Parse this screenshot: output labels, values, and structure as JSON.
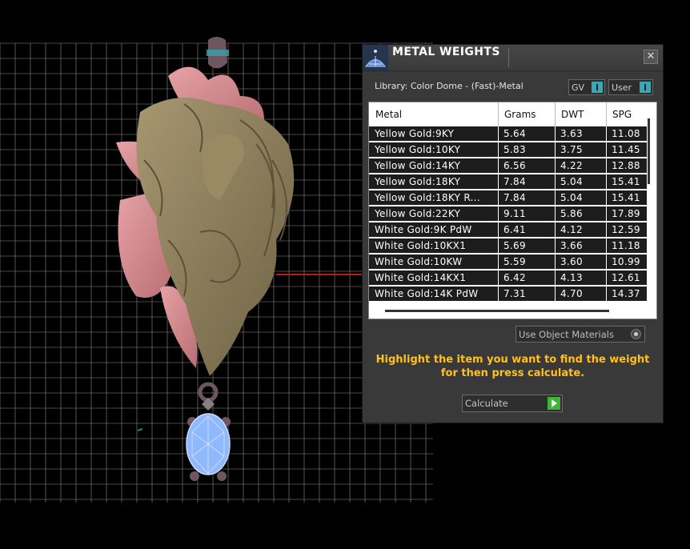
{
  "panel": {
    "title": "METAL WEIGHTS",
    "close_glyph": "✕",
    "library_label": "Library: Color Dome - (Fast)-Metal",
    "toggle_gv_label": "GV",
    "toggle_user_label": "User",
    "table": {
      "headers": [
        "Metal",
        "Grams",
        "DWT",
        "SPG"
      ],
      "rows": [
        {
          "metal": "Yellow Gold:9KY",
          "grams": "5.64",
          "dwt": "3.63",
          "spg": "11.08"
        },
        {
          "metal": "Yellow Gold:10KY",
          "grams": "5.83",
          "dwt": "3.75",
          "spg": "11.45"
        },
        {
          "metal": "Yellow Gold:14KY",
          "grams": "6.56",
          "dwt": "4.22",
          "spg": "12.88"
        },
        {
          "metal": "Yellow Gold:18KY",
          "grams": "7.84",
          "dwt": "5.04",
          "spg": "15.41"
        },
        {
          "metal": "Yellow Gold:18KY R...",
          "grams": "7.84",
          "dwt": "5.04",
          "spg": "15.41"
        },
        {
          "metal": "Yellow Gold:22KY",
          "grams": "9.11",
          "dwt": "5.86",
          "spg": "17.89"
        },
        {
          "metal": "White Gold:9K PdW",
          "grams": "6.41",
          "dwt": "4.12",
          "spg": "12.59"
        },
        {
          "metal": "White Gold:10KX1",
          "grams": "5.69",
          "dwt": "3.66",
          "spg": "11.18"
        },
        {
          "metal": "White Gold:10KW",
          "grams": "5.59",
          "dwt": "3.60",
          "spg": "10.99"
        },
        {
          "metal": "White Gold:14KX1",
          "grams": "6.42",
          "dwt": "4.13",
          "spg": "12.61"
        },
        {
          "metal": "White Gold:14K PdW",
          "grams": "7.31",
          "dwt": "4.70",
          "spg": "14.37"
        }
      ]
    },
    "use_object_materials_label": "Use Object Materials",
    "hint_line1": "Highlight the item you want to find the weight",
    "hint_line2": "for then press calculate.",
    "calculate_label": "Calculate"
  },
  "colors": {
    "panel_bg": "#393939",
    "hint_text": "#ffc11a",
    "toggle_accent": "#3aa7b7",
    "calculate_accent": "#3fb43a",
    "pendant_gold": "#8e7f5c",
    "pendant_pink": "#d98a8f",
    "gem_blue": "#8fb8ff"
  },
  "icons": {
    "app": "blue-dome-icon",
    "close": "close-icon",
    "go": "green-play-icon"
  }
}
